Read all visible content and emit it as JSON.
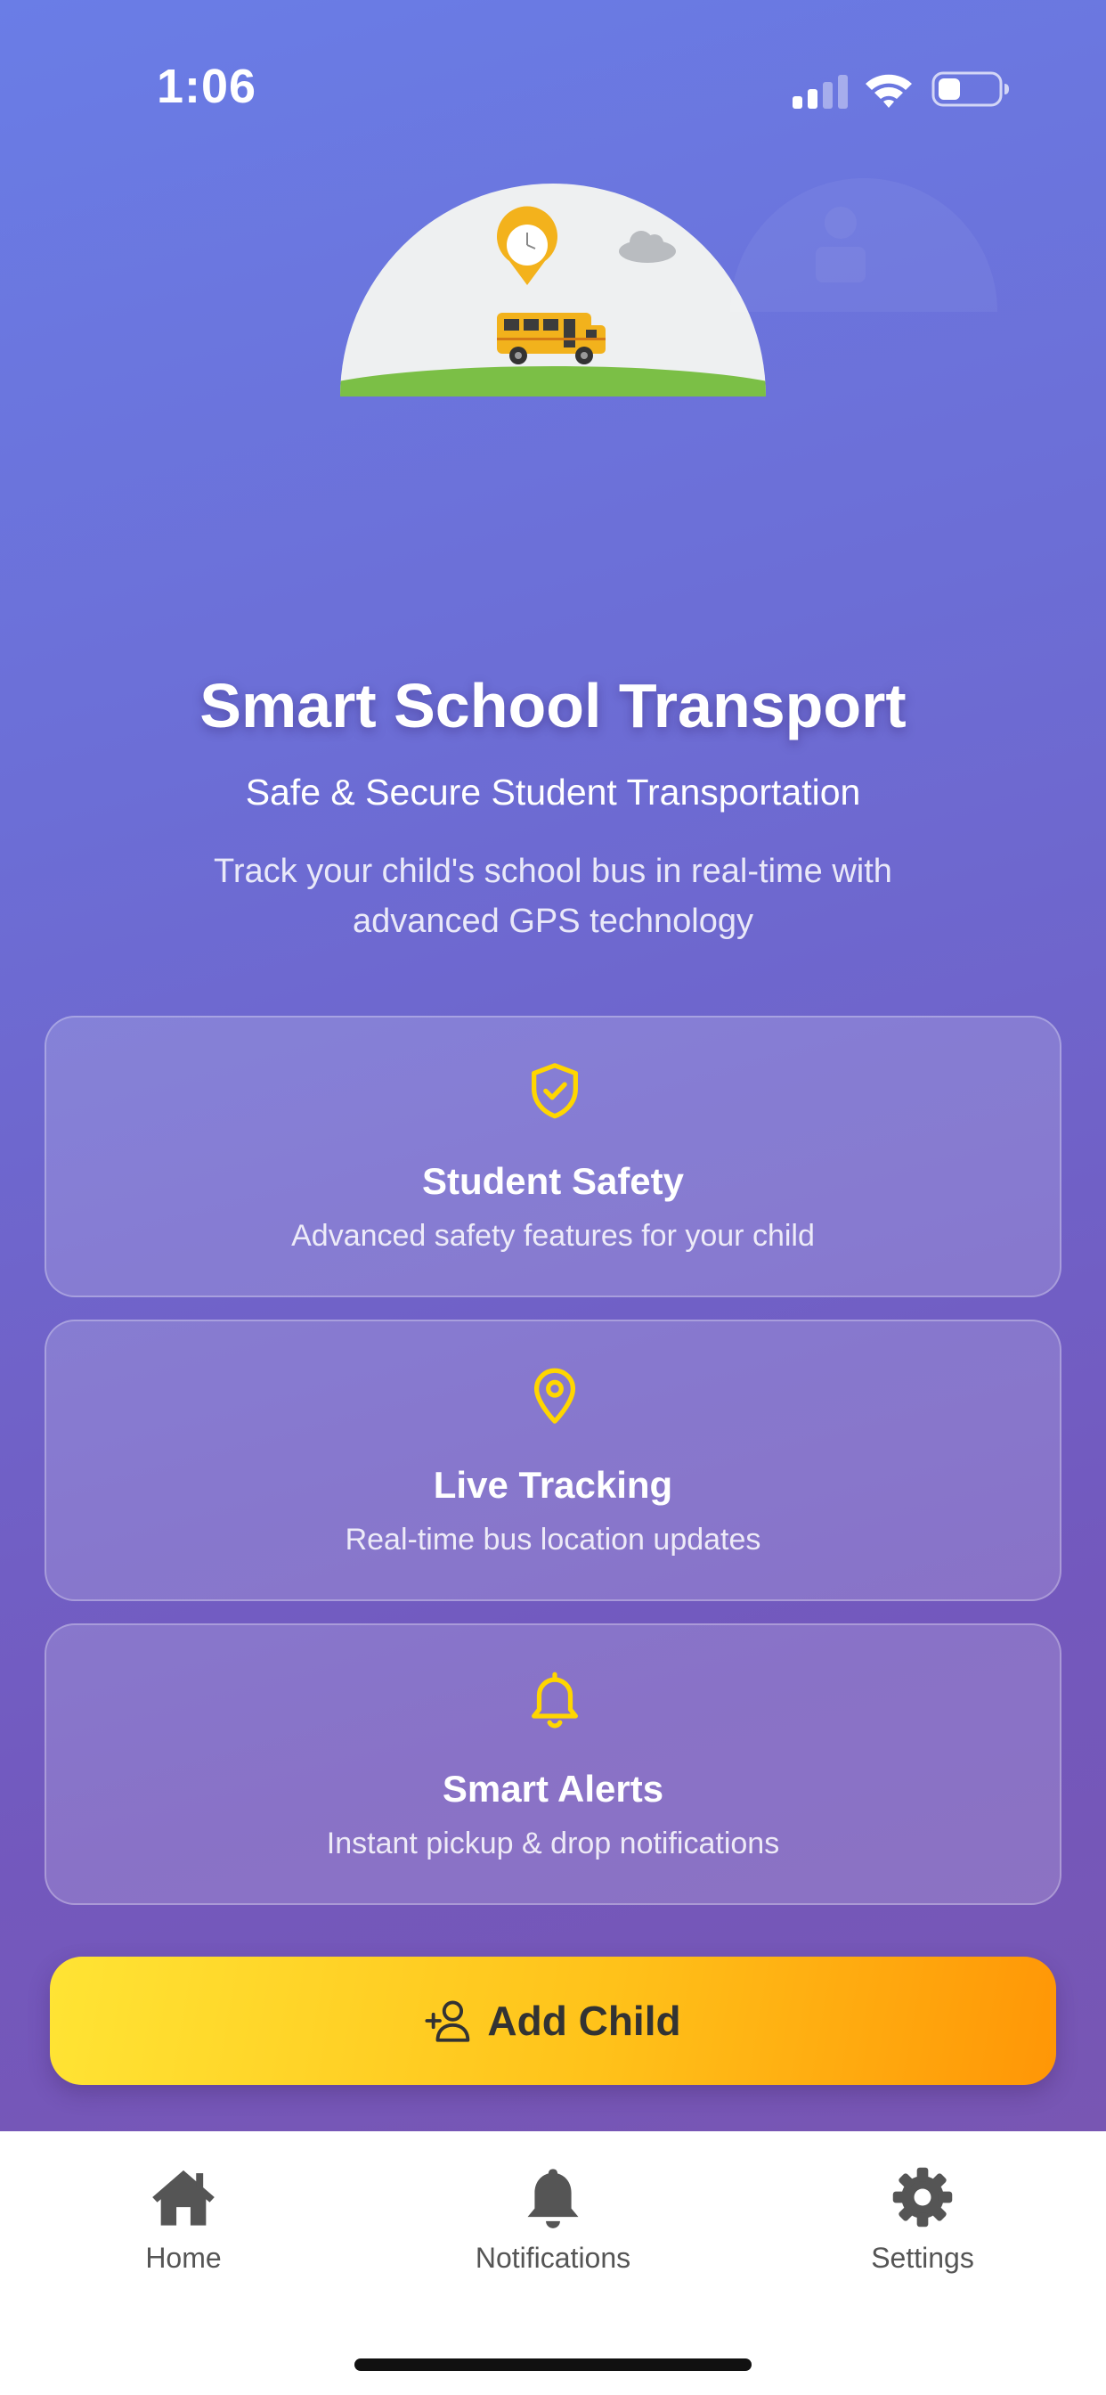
{
  "status_bar": {
    "time": "1:06",
    "signal_icon": "cellular-signal-icon",
    "wifi_icon": "wifi-icon",
    "battery_icon": "battery-icon"
  },
  "hero": {
    "illustration": "school-bus-illustration",
    "icons": [
      "location-pin-clock-icon",
      "cloud-icon",
      "school-bus-icon"
    ]
  },
  "header": {
    "title": "Smart School Transport",
    "subtitle": "Safe & Secure Student Transportation",
    "description": "Track your child's school bus in real-time with advanced GPS technology"
  },
  "features": [
    {
      "icon": "shield-check-icon",
      "title": "Student Safety",
      "description": "Advanced safety features for your child"
    },
    {
      "icon": "location-pin-icon",
      "title": "Live Tracking",
      "description": "Real-time bus location updates"
    },
    {
      "icon": "bell-icon",
      "title": "Smart Alerts",
      "description": "Instant pickup & drop notifications"
    }
  ],
  "primary_action": {
    "label": "Add Child",
    "icon": "add-user-icon"
  },
  "tab_bar": {
    "tabs": [
      {
        "label": "Home",
        "icon": "home-icon"
      },
      {
        "label": "Notifications",
        "icon": "bell-icon"
      },
      {
        "label": "Settings",
        "icon": "gear-icon"
      }
    ]
  },
  "colors": {
    "accent_yellow": "#FFD600",
    "button_gradient_start": "#FFE434",
    "button_gradient_end": "#FF9606",
    "background_top": "#6A7DE6",
    "background_bottom": "#7A55AE",
    "tab_icon": "#555555"
  }
}
